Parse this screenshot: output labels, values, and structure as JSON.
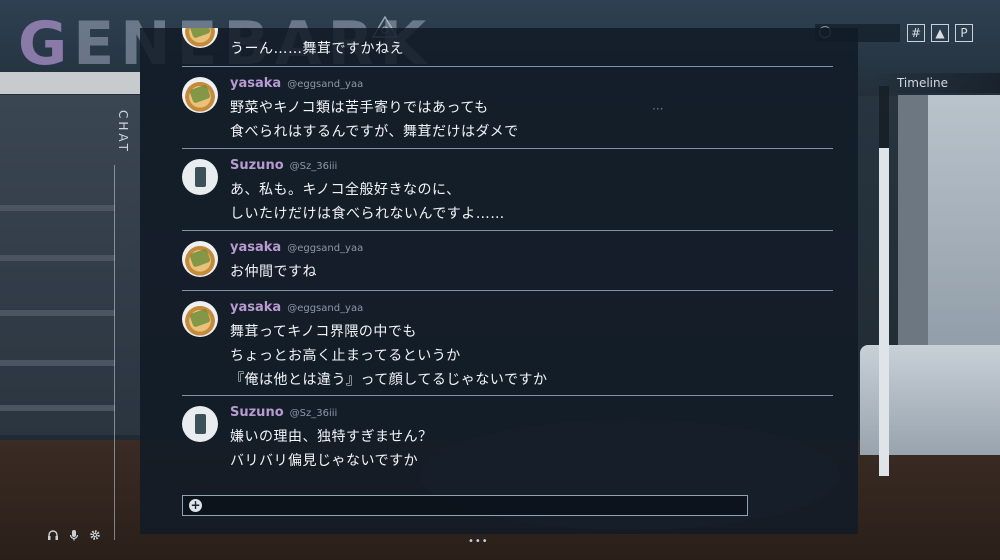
{
  "app": {
    "logo_first": "G",
    "logo_rest": "ENEBARK",
    "side_label": "CHAT"
  },
  "timeline": {
    "label": "Timeline",
    "scroll_fraction": 0.16
  },
  "top_buttons": [
    "#",
    "▲",
    "P"
  ],
  "messages": [
    {
      "user": "",
      "handle": "",
      "avatar": "yasaka-sandwich-avatar",
      "lines": [
        "うーん……舞茸ですかねえ"
      ]
    },
    {
      "user": "yasaka",
      "handle": "@eggsand_yaa",
      "avatar": "yasaka-sandwich-avatar",
      "lines": [
        "野菜やキノコ類は苦手寄りではあっても",
        "食べられはするんですが、舞茸だけはダメで"
      ]
    },
    {
      "user": "Suzuno",
      "handle": "@Sz_36iii",
      "avatar": "suzuno-speaker-avatar",
      "lines": [
        "あ、私も。キノコ全般好きなのに、",
        "しいたけだけは食べられないんですよ……"
      ]
    },
    {
      "user": "yasaka",
      "handle": "@eggsand_yaa",
      "avatar": "yasaka-sandwich-avatar",
      "lines": [
        "お仲間ですね"
      ]
    },
    {
      "user": "yasaka",
      "handle": "@eggsand_yaa",
      "avatar": "yasaka-sandwich-avatar",
      "lines": [
        "舞茸ってキノコ界隈の中でも",
        "ちょっとお高く止まってるというか",
        "『俺は他とは違う』って顔してるじゃないですか"
      ]
    },
    {
      "user": "Suzuno",
      "handle": "@Sz_36iii",
      "avatar": "suzuno-speaker-avatar",
      "lines": [
        "嫌いの理由、独特すぎません？",
        "バリバリ偏見じゃないですか"
      ]
    }
  ],
  "input": {
    "placeholder": ""
  },
  "colors": {
    "username": "#b79ad0",
    "panel": "#121b26",
    "separator": "#7e93a8"
  }
}
